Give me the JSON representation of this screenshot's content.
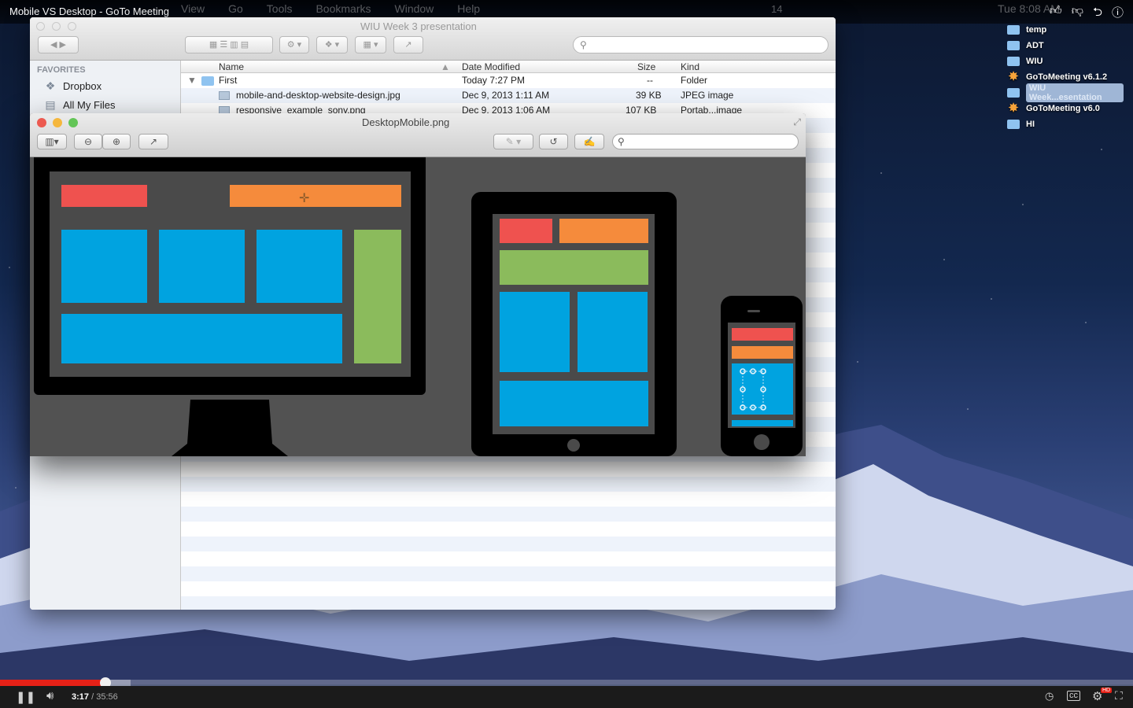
{
  "video": {
    "title": "Mobile VS Desktop - GoTo Meeting",
    "current_time": "3:17",
    "duration": "35:56",
    "progress_fraction": 0.093,
    "buffered_fraction": 0.115,
    "hd_badge": "HD"
  },
  "menubar": {
    "items": [
      "View",
      "Go",
      "Tools",
      "Bookmarks",
      "Window",
      "Help"
    ],
    "battery_text": "14",
    "clock": "Tue 8:08 AM"
  },
  "desktop_icons": [
    {
      "label": "temp",
      "icon": "folder-icon"
    },
    {
      "label": "ADT",
      "icon": "folder-icon"
    },
    {
      "label": "WIU",
      "icon": "folder-icon"
    },
    {
      "label": "GoToMeeting v6.1.2",
      "icon": "gotomeeting-icon"
    },
    {
      "label": "WIU Week...esentation",
      "icon": "folder-icon"
    },
    {
      "label": "GoToMeeting v6.0",
      "icon": "gotomeeting-icon"
    },
    {
      "label": "HI",
      "icon": "folder-icon"
    }
  ],
  "finder": {
    "title": "WIU Week 3 presentation",
    "sidebar_heading": "FAVORITES",
    "sidebar_items": [
      {
        "label": "Dropbox",
        "icon": "dropbox-icon"
      },
      {
        "label": "All My Files",
        "icon": "all-files-icon"
      }
    ],
    "columns": {
      "name": "Name",
      "date": "Date Modified",
      "size": "Size",
      "kind": "Kind"
    },
    "rows": [
      {
        "name": "First",
        "date": "Today 7:27 PM",
        "size": "--",
        "kind": "Folder"
      },
      {
        "name": "mobile-and-desktop-website-design.jpg",
        "date": "Dec 9, 2013 1:11 AM",
        "size": "39 KB",
        "kind": "JPEG image"
      },
      {
        "name": "responsive_example_sony.png",
        "date": "Dec 9, 2013 1:06 AM",
        "size": "107 KB",
        "kind": "Portab...image"
      }
    ]
  },
  "preview": {
    "title": "DesktopMobile.png"
  },
  "colors": {
    "red": "#ef524f",
    "orange": "#f58b3c",
    "blue": "#00a3e0",
    "green": "#8bbb5c",
    "device": "#000000",
    "screen": "#4a4a4a",
    "yt_red": "#e62117"
  }
}
